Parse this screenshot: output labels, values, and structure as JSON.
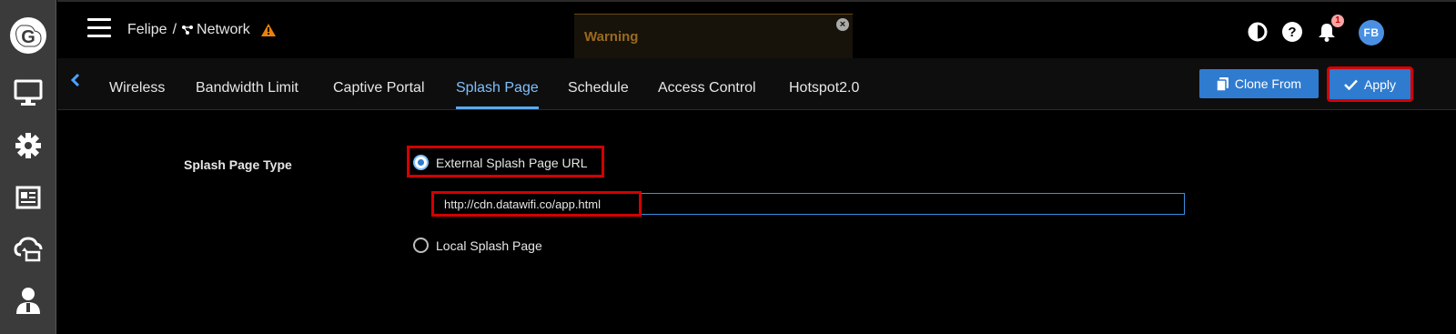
{
  "header": {
    "user": "Felipe",
    "separator": "/",
    "network_label": "Network",
    "avatar_initials": "FB",
    "notifications_count": "1"
  },
  "toast": {
    "text": "Warning"
  },
  "tabs": {
    "items": [
      {
        "label": "Wireless"
      },
      {
        "label": "Bandwidth Limit"
      },
      {
        "label": "Captive Portal"
      },
      {
        "label": "Splash Page"
      },
      {
        "label": "Schedule"
      },
      {
        "label": "Access Control"
      },
      {
        "label": "Hotspot2.0"
      }
    ],
    "active": "Splash Page"
  },
  "actions": {
    "clone_label": "Clone From",
    "apply_label": "Apply"
  },
  "form": {
    "type_label": "Splash Page Type",
    "option_external": "External Splash Page URL",
    "option_local": "Local Splash Page",
    "url_value": "http://cdn.datawifi.co/app.html",
    "selected": "External Splash Page URL"
  },
  "colors": {
    "accent": "#2f7bd0",
    "highlight": "#d40000",
    "warning": "#e8820c"
  }
}
